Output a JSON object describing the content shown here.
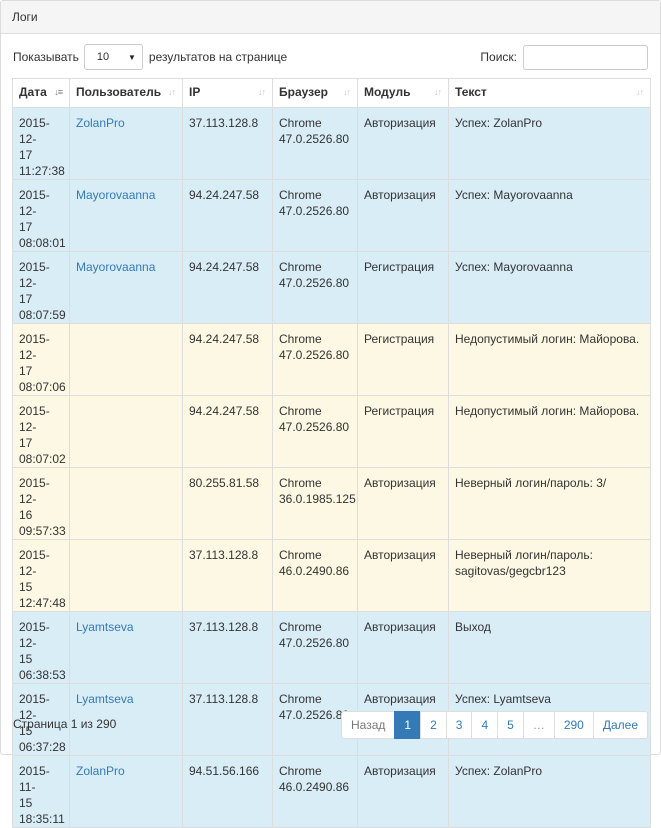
{
  "panel": {
    "title": "Логи"
  },
  "controls": {
    "show_label": "Показывать",
    "page_size": "10",
    "per_page_label": "результатов на странице",
    "search_label": "Поиск:",
    "search_value": ""
  },
  "table": {
    "columns": [
      "Дата",
      "Пользователь",
      "IP",
      "Браузер",
      "Модуль",
      "Текст"
    ],
    "rows": [
      {
        "date": [
          "2015-12-",
          "17",
          "11:27:38"
        ],
        "user": "ZolanPro",
        "ip": "37.113.128.8",
        "browser": [
          "Chrome",
          "47.0.2526.80"
        ],
        "module": "Авторизация",
        "text": "Успех: ZolanPro"
      },
      {
        "date": [
          "2015-12-",
          "17",
          "08:08:01"
        ],
        "user": "Mayorovaanna",
        "ip": "94.24.247.58",
        "browser": [
          "Chrome",
          "47.0.2526.80"
        ],
        "module": "Авторизация",
        "text": "Успех: Mayorovaanna"
      },
      {
        "date": [
          "2015-12-",
          "17",
          "08:07:59"
        ],
        "user": "Mayorovaanna",
        "ip": "94.24.247.58",
        "browser": [
          "Chrome",
          "47.0.2526.80"
        ],
        "module": "Регистрация",
        "text": "Успех: Mayorovaanna"
      },
      {
        "date": [
          "2015-12-",
          "17",
          "08:07:06"
        ],
        "user": "",
        "ip": "94.24.247.58",
        "browser": [
          "Chrome",
          "47.0.2526.80"
        ],
        "module": "Регистрация",
        "text": "Недопустимый логин: Майорова."
      },
      {
        "date": [
          "2015-12-",
          "17",
          "08:07:02"
        ],
        "user": "",
        "ip": "94.24.247.58",
        "browser": [
          "Chrome",
          "47.0.2526.80"
        ],
        "module": "Регистрация",
        "text": "Недопустимый логин: Майорова."
      },
      {
        "date": [
          "2015-12-",
          "16",
          "09:57:33"
        ],
        "user": "",
        "ip": "80.255.81.58",
        "browser": [
          "Chrome",
          "36.0.1985.125"
        ],
        "module": "Авторизация",
        "text": "Неверный логин/пароль: 3/"
      },
      {
        "date": [
          "2015-12-",
          "15",
          "12:47:48"
        ],
        "user": "",
        "ip": "37.113.128.8",
        "browser": [
          "Chrome",
          "46.0.2490.86"
        ],
        "module": "Авторизация",
        "text": "Неверный логин/пароль: sagitovas/gegcbr123"
      },
      {
        "date": [
          "2015-12-",
          "15",
          "06:38:53"
        ],
        "user": "Lyamtseva",
        "ip": "37.113.128.8",
        "browser": [
          "Chrome",
          "47.0.2526.80"
        ],
        "module": "Авторизация",
        "text": "Выход"
      },
      {
        "date": [
          "2015-12-",
          "15",
          "06:37:28"
        ],
        "user": "Lyamtseva",
        "ip": "37.113.128.8",
        "browser": [
          "Chrome",
          "47.0.2526.80"
        ],
        "module": "Авторизация",
        "text": "Успех: Lyamtseva"
      },
      {
        "date": [
          "2015-11-",
          "15",
          "18:35:11"
        ],
        "user": "ZolanPro",
        "ip": "94.51.56.166",
        "browser": [
          "Chrome",
          "46.0.2490.86"
        ],
        "module": "Авторизация",
        "text": "Успех: ZolanPro"
      }
    ]
  },
  "footer": {
    "page_info": "Страница 1 из 290",
    "pagination": [
      "Назад",
      "1",
      "2",
      "3",
      "4",
      "5",
      "…",
      "290",
      "Далее"
    ],
    "active_page": "1"
  },
  "colors": {
    "success_row": "#d9edf7",
    "failure_row": "#fcf8e3",
    "link": "#337ab7"
  }
}
